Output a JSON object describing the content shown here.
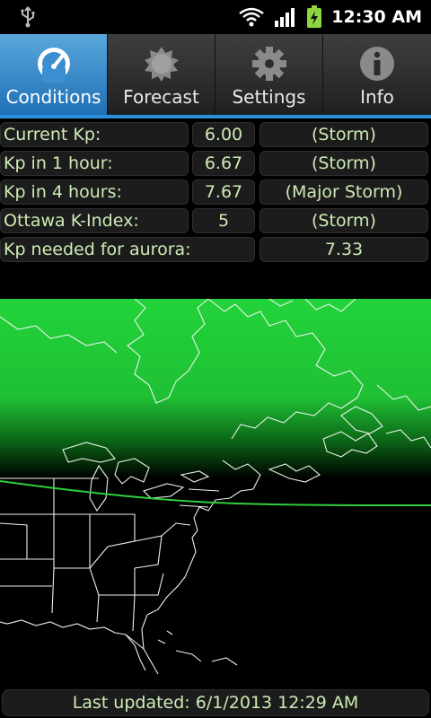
{
  "status_bar": {
    "time": "12:30 AM"
  },
  "tabs": [
    {
      "label": "Conditions",
      "icon": "gauge-icon",
      "active": true
    },
    {
      "label": "Forecast",
      "icon": "sun-icon",
      "active": false
    },
    {
      "label": "Settings",
      "icon": "gear-icon",
      "active": false
    },
    {
      "label": "Info",
      "icon": "info-icon",
      "active": false
    }
  ],
  "conditions": [
    {
      "label": "Current Kp:",
      "value": "6.00",
      "status": "(Storm)"
    },
    {
      "label": "Kp in 1 hour:",
      "value": "6.67",
      "status": "(Storm)"
    },
    {
      "label": "Kp in 4 hours:",
      "value": "7.67",
      "status": "(Major Storm)"
    },
    {
      "label": "Ottawa K-Index:",
      "value": "5",
      "status": "(Storm)"
    }
  ],
  "aurora_needed": {
    "label": "Kp needed for aurora:",
    "value": "7.33"
  },
  "footer": {
    "last_updated": "Last updated: 6/1/2013 12:29 AM"
  },
  "colors": {
    "accent": "#2a8fd8",
    "aurora_green": "#22d33a",
    "text": "#cdebb4"
  }
}
